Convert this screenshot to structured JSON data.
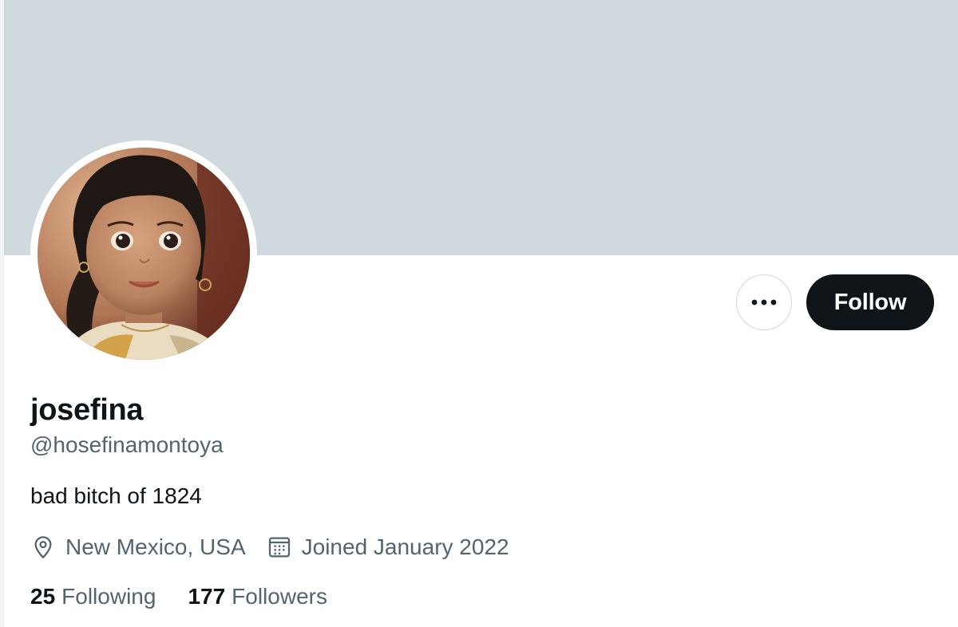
{
  "profile": {
    "display_name": "josefina",
    "handle": "@hosefinamontoya",
    "bio": "bad bitch of 1824",
    "location": "New Mexico, USA",
    "joined": "Joined January 2022",
    "location_icon": "location-pin-icon",
    "calendar_icon": "calendar-icon"
  },
  "stats": {
    "following_count": "25",
    "following_label": "Following",
    "followers_count": "177",
    "followers_label": "Followers"
  },
  "actions": {
    "more_icon": "more-horizontal-icon",
    "follow_label": "Follow"
  },
  "colors": {
    "banner": "#cfd9de",
    "primary_text": "#0f1419",
    "secondary_text": "#536471",
    "follow_button_bg": "#0f1419"
  }
}
